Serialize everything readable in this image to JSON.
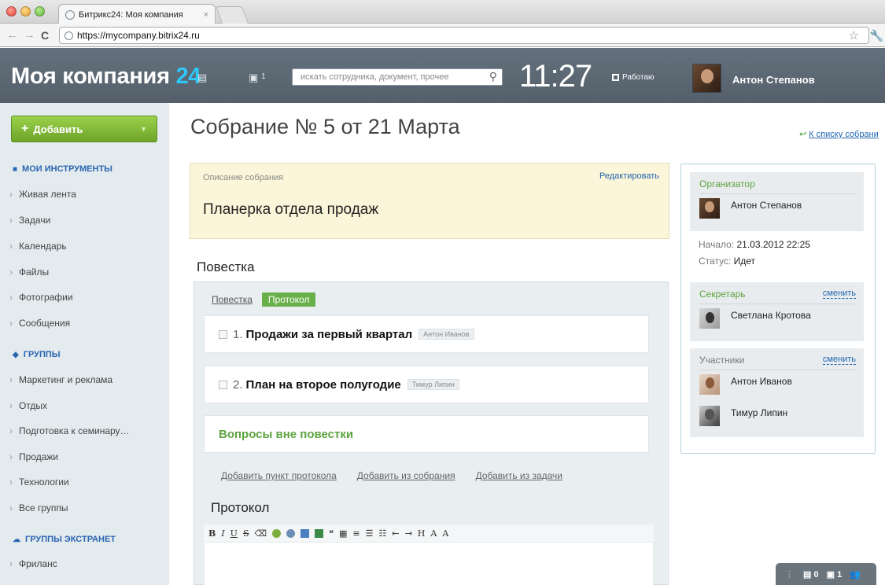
{
  "browser": {
    "tab_title": "Битрикс24: Моя компания",
    "tab_close": "×",
    "url": "https://mycompany.bitrix24.ru",
    "nav": {
      "back": "←",
      "forward": "→",
      "reload": "C",
      "star": "☆",
      "wrench": "🔧"
    }
  },
  "header": {
    "logo_text": "Моя компания ",
    "logo_number": "24",
    "notif_count": "1",
    "search_placeholder": "искать сотрудника, документ, прочее",
    "clock": "11:27",
    "work_status": "Работаю",
    "user_name": "Антон Степанов"
  },
  "sidebar": {
    "add_label": "Добавить",
    "sections": [
      {
        "title": "МОИ ИНСТРУМЕНТЫ",
        "items": [
          "Живая лента",
          "Задачи",
          "Календарь",
          "Файлы",
          "Фотографии",
          "Сообщения"
        ]
      },
      {
        "title": "ГРУППЫ",
        "items": [
          "Маркетинг и реклама",
          "Отдых",
          "Подготовка к семинару…",
          "Продажи",
          "Технологии",
          "Все группы"
        ]
      },
      {
        "title": "ГРУППЫ ЭКСТРАНЕТ",
        "items": [
          "Фриланс"
        ]
      }
    ]
  },
  "main": {
    "title": "Собрание № 5 от 21 Марта",
    "back_link": "К списку собрани",
    "description": {
      "label": "Описание собрания",
      "edit": "Редактировать",
      "text": "Планерка отдела продаж"
    },
    "agenda_heading": "Повестка",
    "tabs": {
      "agenda": "Повестка",
      "protocol": "Протокол"
    },
    "items": [
      {
        "num": "1.",
        "title": "Продажи за первый квартал",
        "owner": "Антон Иванов"
      },
      {
        "num": "2.",
        "title": "План на второе полугодие",
        "owner": "Тимур Липин"
      }
    ],
    "extra_section": "Вопросы вне повестки",
    "actions": [
      "Добавить пункт протокола",
      "Добавить из собрания",
      "Добавить из задачи"
    ],
    "protocol_heading": "Протокол",
    "toolbar": [
      "B",
      "I",
      "U",
      "S",
      "H",
      "A",
      "A"
    ]
  },
  "right": {
    "organizer_title": "Организатор",
    "organizer_name": "Антон Степанов",
    "start_label": "Начало:",
    "start_value": "21.03.2012 22:25",
    "status_label": "Статус:",
    "status_value": "Идет",
    "secretary_title": "Секретарь",
    "secretary_change": "сменить",
    "secretary_name": "Светлана Кротова",
    "members_title": "Участники",
    "members_change": "сменить",
    "members": [
      "Антон Иванов",
      "Тимур Липин"
    ]
  },
  "status_widget": {
    "messages": "0",
    "notifications": "1"
  },
  "colors": {
    "header_bg": "#5c6a76",
    "accent_blue": "#2fc7f7",
    "green": "#69b04a",
    "link": "#2067b0"
  }
}
